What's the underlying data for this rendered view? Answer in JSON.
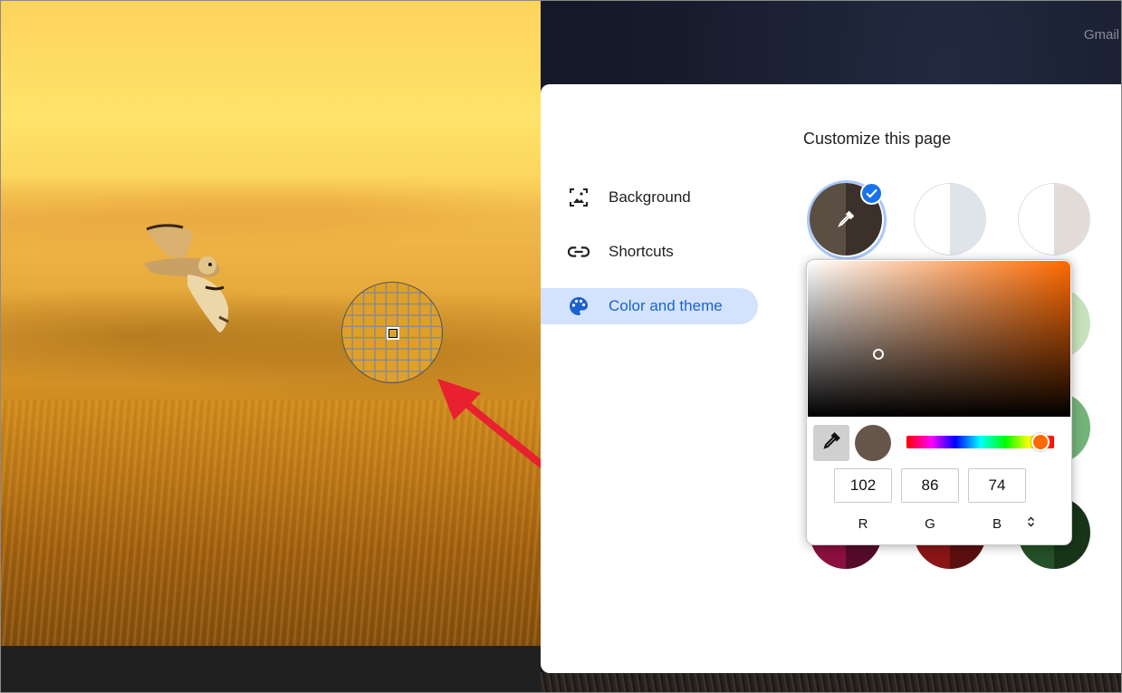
{
  "background_photo": {
    "description": "Owl flying over golden grass field",
    "colors": {
      "sky": "#ffe36a",
      "field": "#cc8a1f"
    }
  },
  "eyedropper_loupe": {
    "sampled_color": "#e0a028"
  },
  "annotation": {
    "arrow_color": "#e8202f"
  },
  "new_tab": {
    "header_link": "Gmail"
  },
  "customize_panel": {
    "title": "Customize this page",
    "nav": [
      {
        "label": "Background",
        "icon": "image-icon",
        "active": false
      },
      {
        "label": "Shortcuts",
        "icon": "link-icon",
        "active": false
      },
      {
        "label": "Color and theme",
        "icon": "palette-icon",
        "active": true
      }
    ],
    "accent_color": "#1a73e8",
    "active_nav_bg": "#d3e3fd",
    "swatches": [
      {
        "name": "custom-color",
        "left": "#5b4e43",
        "right": "#3b302a",
        "selected": true,
        "icon": "eyedropper-icon"
      },
      {
        "name": "default-light-blue",
        "left": "#ffffff",
        "right": "#dfe3ea",
        "selected": false
      },
      {
        "name": "warm-grey",
        "left": "#ffffff",
        "right": "#e3dbd7",
        "selected": false
      },
      {
        "name": "light-green",
        "left": "#dbecd3",
        "right": "#c7e3bd",
        "selected": false
      },
      {
        "name": "green",
        "left": "#8cc08a",
        "right": "#74b37a",
        "selected": false
      },
      {
        "name": "magenta",
        "left": "#8b1040",
        "right": "#560b2a",
        "selected": false
      },
      {
        "name": "red",
        "left": "#8a1616",
        "right": "#5c0f0f",
        "selected": false
      },
      {
        "name": "dark-green",
        "left": "#245127",
        "right": "#18351a",
        "selected": false
      }
    ]
  },
  "color_picker": {
    "hue_color": "#ff6a00",
    "selected_color": "#66564a",
    "hue_position": 0.91,
    "saturation": 0.27,
    "value": 0.4,
    "r": "102",
    "g": "86",
    "b": "74",
    "labels": {
      "r": "R",
      "g": "G",
      "b": "B"
    },
    "eyedropper_button": "eyedropper-icon",
    "mode_toggle": "up-down-chevron-icon"
  }
}
